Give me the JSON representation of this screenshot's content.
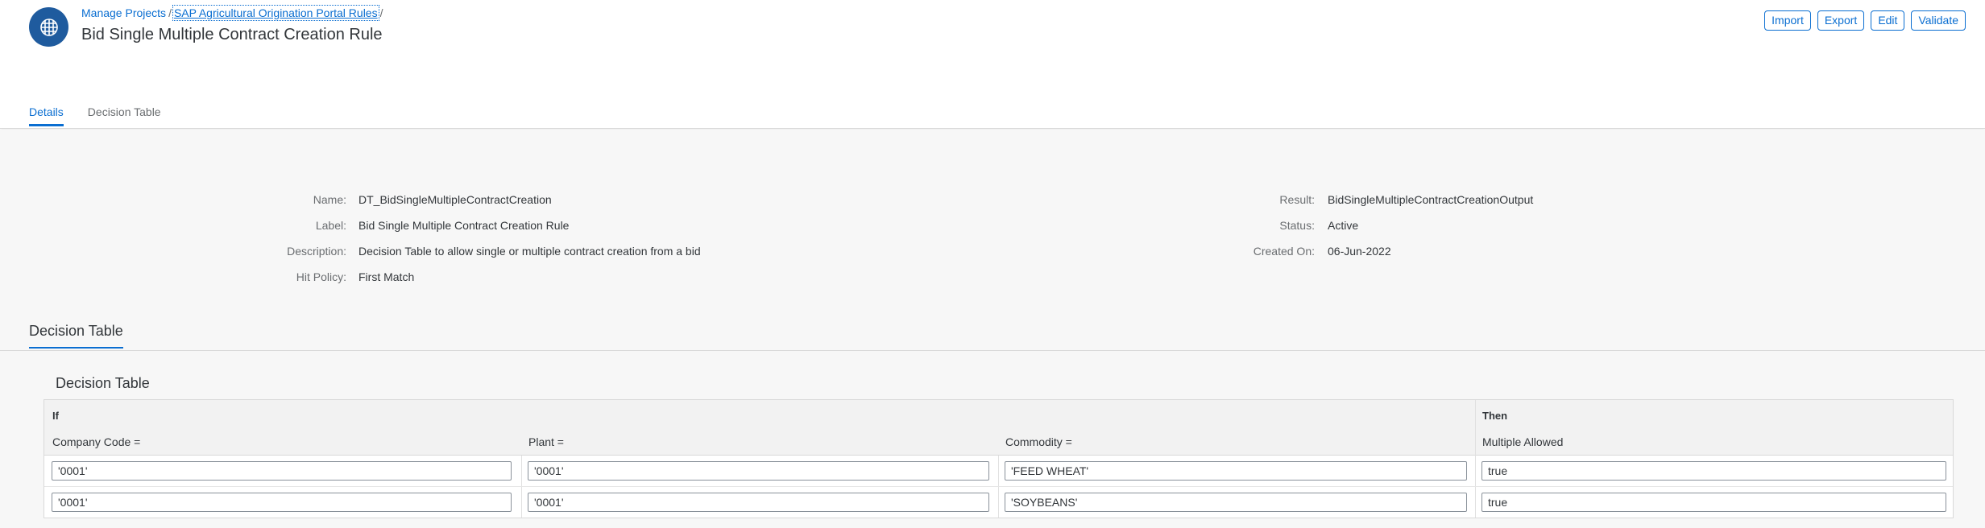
{
  "header": {
    "breadcrumbs": [
      {
        "label": "Manage Projects"
      },
      {
        "label": "SAP Agricultural Origination Portal Rules"
      }
    ],
    "separator": "/",
    "title": "Bid Single Multiple Contract Creation Rule",
    "app_icon": "table-grid-icon"
  },
  "actions": {
    "import": "Import",
    "export": "Export",
    "edit": "Edit",
    "validate": "Validate"
  },
  "tabs": [
    {
      "label": "Details",
      "active": true
    },
    {
      "label": "Decision Table",
      "active": false
    }
  ],
  "details": {
    "left": [
      {
        "label": "Name:",
        "value": "DT_BidSingleMultipleContractCreation"
      },
      {
        "label": "Label:",
        "value": "Bid Single Multiple Contract Creation Rule"
      },
      {
        "label": "Description:",
        "value": "Decision Table to allow single or multiple contract creation from a bid"
      },
      {
        "label": "Hit Policy:",
        "value": "First Match"
      }
    ],
    "right": [
      {
        "label": "Result:",
        "value": "BidSingleMultipleContractCreationOutput"
      },
      {
        "label": "Status:",
        "value": "Active"
      },
      {
        "label": "Created On:",
        "value": "06-Jun-2022"
      }
    ]
  },
  "section_title": "Decision Table",
  "decision_table": {
    "title": "Decision Table",
    "if_label": "If",
    "then_label": "Then",
    "columns": [
      "Company Code =",
      "Plant =",
      "Commodity =",
      "Multiple Allowed"
    ],
    "rows": [
      [
        "'0001'",
        "'0001'",
        "'FEED WHEAT'",
        "true"
      ],
      [
        "'0001'",
        "'0001'",
        "'SOYBEANS'",
        "true"
      ]
    ]
  },
  "colors": {
    "accent": "#0a6ed1",
    "icon_bg": "#1f5b9e",
    "background": "#f7f7f7"
  }
}
